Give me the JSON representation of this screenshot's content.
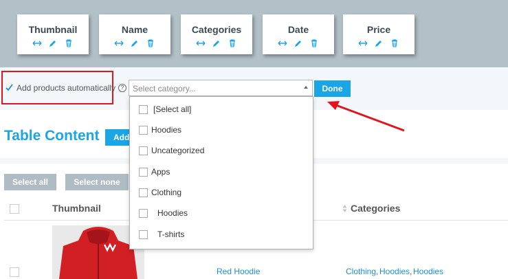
{
  "columns": [
    {
      "name": "Thumbnail"
    },
    {
      "name": "Name"
    },
    {
      "name": "Categories"
    },
    {
      "name": "Date"
    },
    {
      "name": "Price"
    }
  ],
  "settings": {
    "auto_add_label": "Add products automatically",
    "auto_add_checked": true,
    "help_label": "?",
    "select_placeholder": "Select category...",
    "done_label": "Done",
    "options": [
      {
        "label": "[Select all]"
      },
      {
        "label": "Hoodies"
      },
      {
        "label": "Uncategorized"
      },
      {
        "label": "Apps"
      },
      {
        "label": "Clothing"
      },
      {
        "label": "Hoodies"
      },
      {
        "label": "T-shirts"
      }
    ]
  },
  "table": {
    "title": "Table Content",
    "add_label": "Add",
    "select_all_label": "Select all",
    "select_none_label": "Select none",
    "headers": {
      "thumbnail": "Thumbnail",
      "categories": "Categories"
    },
    "rows": [
      {
        "name": "Red Hoodie",
        "categories": [
          "Clothing",
          "Hoodies",
          "Hoodies"
        ]
      }
    ]
  },
  "colors": {
    "accent": "#1aa5e6",
    "highlight": "#e3141b",
    "band": "#b2c0c8"
  }
}
